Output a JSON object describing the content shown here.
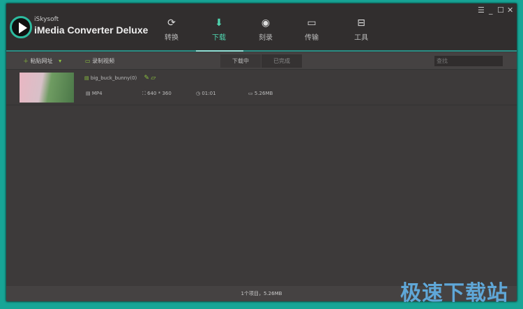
{
  "app": {
    "brand_small": "iSkysoft",
    "brand_name": "iMedia Converter Deluxe"
  },
  "tabs": [
    {
      "label": "转换",
      "icon": "convert-icon"
    },
    {
      "label": "下载",
      "icon": "download-icon",
      "active": true
    },
    {
      "label": "刻录",
      "icon": "burn-icon"
    },
    {
      "label": "传输",
      "icon": "transfer-icon"
    },
    {
      "label": "工具",
      "icon": "toolbox-icon"
    }
  ],
  "window_controls": {
    "menu": "☰",
    "minimize": "_",
    "maximize": "☐",
    "close": "✕"
  },
  "toolbar": {
    "paste_url": "粘贴网址",
    "record_video": "录制视频",
    "downloading": "下载中",
    "completed": "已完成",
    "search_placeholder": "查找"
  },
  "items": [
    {
      "name": "big_buck_bunny(0)",
      "format": "MP4",
      "resolution": "640 * 360",
      "duration": "01:01",
      "size": "5.26MB"
    }
  ],
  "status": {
    "summary": "1个项目，5.26MB"
  },
  "watermark": "极速下载站",
  "colors": {
    "accent": "#4fd6b0",
    "frame": "#17a596",
    "icon_green": "#8dc63f"
  }
}
